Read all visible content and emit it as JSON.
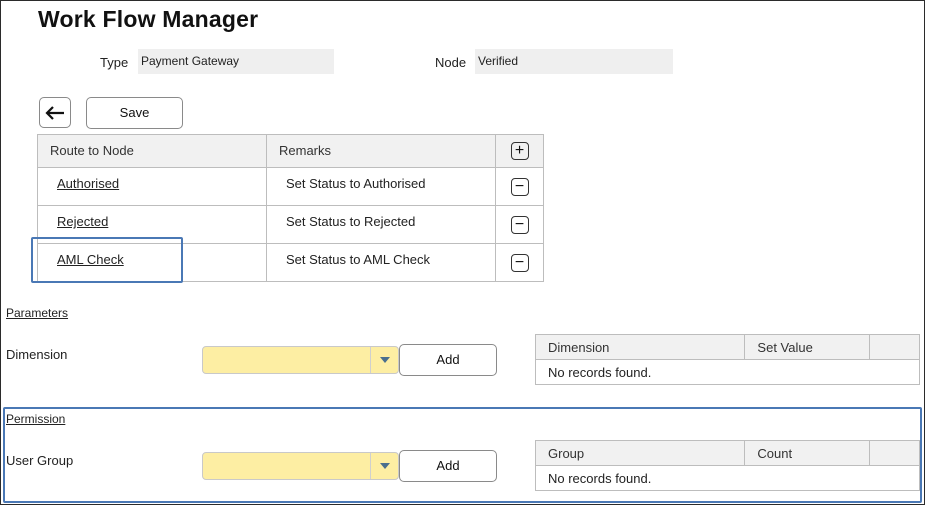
{
  "title": "Work Flow Manager",
  "fields": {
    "type_label": "Type",
    "type_value": "Payment Gateway",
    "node_label": "Node",
    "node_value": "Verified"
  },
  "toolbar": {
    "back_icon": "arrow-left-icon",
    "save_label": "Save"
  },
  "routes": {
    "headers": [
      "Route to Node",
      "Remarks"
    ],
    "add_icon": "plus-icon",
    "remove_icon": "minus-icon",
    "rows": [
      {
        "node": "Authorised",
        "remarks": "Set Status to Authorised"
      },
      {
        "node": "Rejected",
        "remarks": "Set Status to Rejected"
      },
      {
        "node": "AML Check",
        "remarks": "Set Status to AML Check"
      }
    ]
  },
  "parameters": {
    "section_label": "Parameters",
    "field_label": "Dimension",
    "select_value": "",
    "add_label": "Add",
    "headers": [
      "Dimension",
      "Set Value"
    ],
    "empty_text": "No records found."
  },
  "permission": {
    "section_label": "Permission",
    "field_label": "User Group",
    "select_value": "",
    "add_label": "Add",
    "headers": [
      "Group",
      "Count"
    ],
    "empty_text": "No records found."
  },
  "colors": {
    "highlight": "#4a78b5",
    "select_bg": "#fdeea3"
  }
}
